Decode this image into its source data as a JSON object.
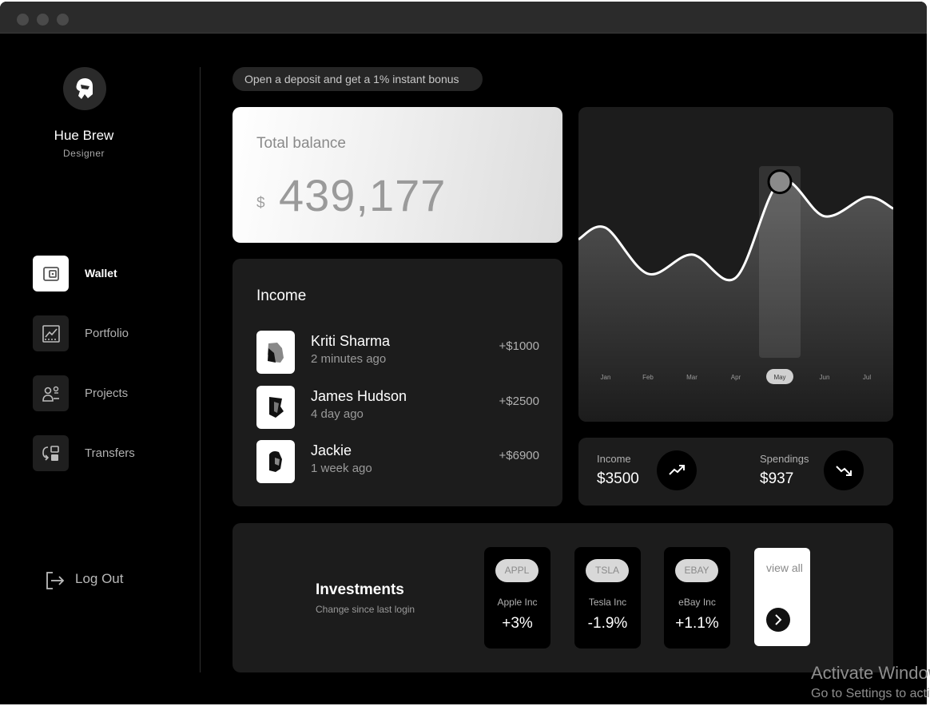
{
  "user": {
    "name": "Hue Brew",
    "role": "Designer"
  },
  "nav": {
    "items": [
      {
        "label": "Wallet",
        "icon": "wallet-icon",
        "active": true
      },
      {
        "label": "Portfolio",
        "icon": "chart-icon",
        "active": false
      },
      {
        "label": "Projects",
        "icon": "projects-icon",
        "active": false
      },
      {
        "label": "Transfers",
        "icon": "transfers-icon",
        "active": false
      }
    ],
    "logout": "Log Out"
  },
  "promo": "Open a deposit and get a 1% instant bonus",
  "balance": {
    "title": "Total balance",
    "currency": "$",
    "amount": "439,177"
  },
  "income": {
    "title": "Income",
    "rows": [
      {
        "name": "Kriti Sharma",
        "time": "2 minutes ago",
        "amount": "+$1000"
      },
      {
        "name": "James Hudson",
        "time": "4 day ago",
        "amount": "+$2500"
      },
      {
        "name": "Jackie",
        "time": "1 week ago",
        "amount": "+$6900"
      }
    ]
  },
  "chart_data": {
    "type": "area",
    "categories": [
      "Jan",
      "Feb",
      "Mar",
      "Apr",
      "May",
      "Jun",
      "Jul"
    ],
    "values": [
      62,
      38,
      48,
      36,
      86,
      68,
      78
    ],
    "highlighted": "May",
    "ylim": [
      0,
      100
    ],
    "title": "",
    "xlabel": "",
    "ylabel": ""
  },
  "stats": {
    "income": {
      "label": "Income",
      "value": "$3500"
    },
    "spendings": {
      "label": "Spendings",
      "value": "$937"
    }
  },
  "investments": {
    "title": "Investments",
    "subtitle": "Change since last login",
    "stocks": [
      {
        "ticker": "APPL",
        "name": "Apple Inc",
        "change": "+3%"
      },
      {
        "ticker": "TSLA",
        "name": "Tesla Inc",
        "change": "-1.9%"
      },
      {
        "ticker": "EBAY",
        "name": "eBay Inc",
        "change": "+1.1%"
      }
    ],
    "view_all": "view all"
  },
  "watermark": {
    "line1": "Activate Windows",
    "line2": "Go to Settings to activate Windows."
  },
  "colors": {
    "background": "#000000",
    "card": "#1c1c1c",
    "accent": "#ffffff"
  }
}
